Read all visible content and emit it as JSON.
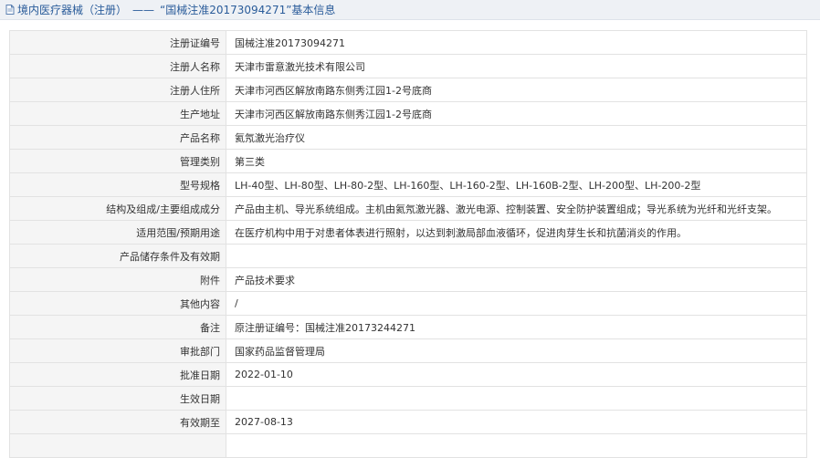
{
  "header": {
    "icon": "document-icon",
    "title": "境内医疗器械（注册）",
    "dash": "——",
    "subtitle": "“国械注准20173094271”基本信息"
  },
  "rows": [
    {
      "label": "注册证编号",
      "value": "国械注准20173094271"
    },
    {
      "label": "注册人名称",
      "value": "天津市雷意激光技术有限公司"
    },
    {
      "label": "注册人住所",
      "value": "天津市河西区解放南路东侧秀江园1-2号底商"
    },
    {
      "label": "生产地址",
      "value": "天津市河西区解放南路东侧秀江园1-2号底商"
    },
    {
      "label": "产品名称",
      "value": "氦氖激光治疗仪"
    },
    {
      "label": "管理类别",
      "value": "第三类"
    },
    {
      "label": "型号规格",
      "value": "LH-40型、LH-80型、LH-80-2型、LH-160型、LH-160-2型、LH-160B-2型、LH-200型、LH-200-2型"
    },
    {
      "label": "结构及组成/主要组成成分",
      "value": "产品由主机、导光系统组成。主机由氦氖激光器、激光电源、控制装置、安全防护装置组成；导光系统为光纤和光纤支架。"
    },
    {
      "label": "适用范围/预期用途",
      "value": "在医疗机构中用于对患者体表进行照射，以达到刺激局部血液循环，促进肉芽生长和抗菌消炎的作用。"
    },
    {
      "label": "产品储存条件及有效期",
      "value": ""
    },
    {
      "label": "附件",
      "value": "产品技术要求"
    },
    {
      "label": "其他内容",
      "value": "/"
    },
    {
      "label": "备注",
      "value": "原注册证编号：国械注准20173244271"
    },
    {
      "label": "审批部门",
      "value": "国家药品监督管理局"
    },
    {
      "label": "批准日期",
      "value": "2022-01-10"
    },
    {
      "label": "生效日期",
      "value": ""
    },
    {
      "label": "有效期至",
      "value": "2027-08-13"
    },
    {
      "label": "",
      "value": ""
    }
  ]
}
